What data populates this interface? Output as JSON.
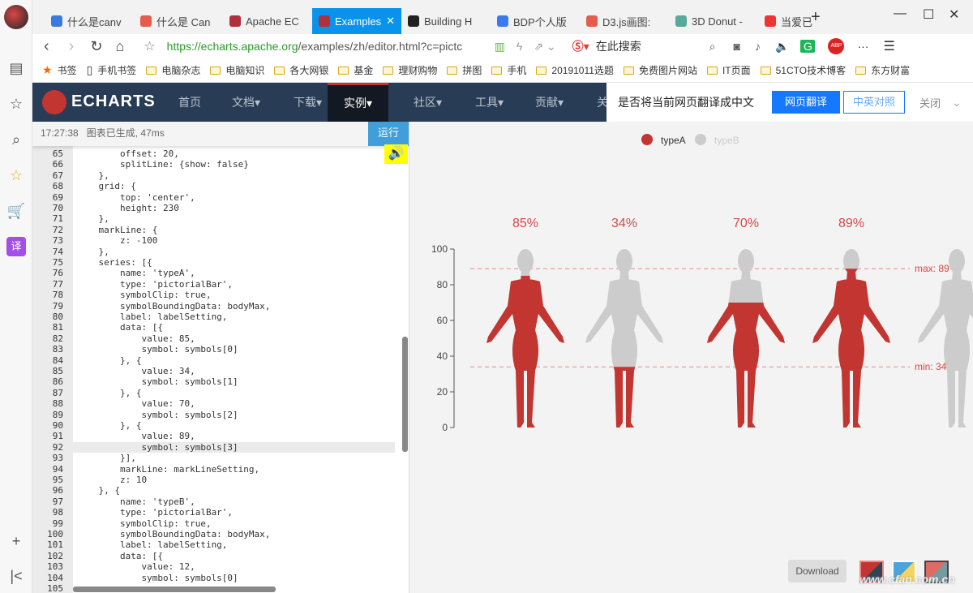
{
  "browser": {
    "tabs": [
      {
        "label": "什么是canv",
        "icon": "paw-icon",
        "color": "#3b7be0"
      },
      {
        "label": "什么是 Can",
        "icon": "jian-icon",
        "color": "#e35c4d"
      },
      {
        "label": "Apache EC",
        "icon": "echarts-icon",
        "color": "#b0303d"
      },
      {
        "label": "Examples",
        "icon": "echarts-icon",
        "color": "#b0303d",
        "active": true
      },
      {
        "label": "Building H",
        "icon": "cm-icon",
        "color": "#222"
      },
      {
        "label": "BDP个人版",
        "icon": "b-icon",
        "color": "#3a7cf0"
      },
      {
        "label": "D3.js画图:",
        "icon": "jian-icon",
        "color": "#e35c4d"
      },
      {
        "label": "3D Donut -",
        "icon": "donut-icon",
        "color": "#5a9"
      },
      {
        "label": "当爱已",
        "icon": "music-icon",
        "color": "#e33"
      }
    ],
    "url_host": "https://echarts.apache.org",
    "url_path": "/examples/zh/editor.html?c=pictc",
    "search_placeholder": "在此搜索",
    "bookmarks": [
      "书签",
      "手机书签",
      "电脑杂志",
      "电脑知识",
      "各大网银",
      "基金",
      "理财购物",
      "拼图",
      "手机",
      "20191011选题",
      "免费图片网站",
      "IT页面",
      "51CTO技术博客",
      "东方财富"
    ]
  },
  "site_nav": {
    "logo": "ECHARTS",
    "items": [
      "首页",
      "文档▾",
      "下载▾",
      "实例▾",
      "社区▾",
      "工具▾",
      "贡献▾",
      "关"
    ],
    "active": 3
  },
  "translate_bar": {
    "prompt": "是否将当前网页翻译成中文",
    "translate": "网页翻译",
    "bilingual": "中英对照",
    "close": "关闭"
  },
  "editor": {
    "status_time": "17:27:38",
    "status_msg": "图表已生成, 47ms",
    "run": "运行",
    "current_line": 92,
    "lines": [
      [
        "65",
        "        offset: 20,"
      ],
      [
        "66",
        "        splitLine: {show: false}"
      ],
      [
        "67",
        "    },"
      ],
      [
        "68",
        "    grid: {"
      ],
      [
        "69",
        "        top: 'center',"
      ],
      [
        "70",
        "        height: 230"
      ],
      [
        "71",
        "    },"
      ],
      [
        "72",
        "    markLine: {"
      ],
      [
        "73",
        "        z: -100"
      ],
      [
        "74",
        "    },"
      ],
      [
        "75",
        "    series: [{"
      ],
      [
        "76",
        "        name: 'typeA',"
      ],
      [
        "77",
        "        type: 'pictorialBar',"
      ],
      [
        "78",
        "        symbolClip: true,"
      ],
      [
        "79",
        "        symbolBoundingData: bodyMax,"
      ],
      [
        "80",
        "        label: labelSetting,"
      ],
      [
        "81",
        "        data: [{"
      ],
      [
        "82",
        "            value: 85,"
      ],
      [
        "83",
        "            symbol: symbols[0]"
      ],
      [
        "84",
        "        }, {"
      ],
      [
        "85",
        "            value: 34,"
      ],
      [
        "86",
        "            symbol: symbols[1]"
      ],
      [
        "87",
        "        }, {"
      ],
      [
        "88",
        "            value: 70,"
      ],
      [
        "89",
        "            symbol: symbols[2]"
      ],
      [
        "90",
        "        }, {"
      ],
      [
        "91",
        "            value: 89,"
      ],
      [
        "92",
        "            symbol: symbols[3]"
      ],
      [
        "93",
        "        }],"
      ],
      [
        "94",
        "        markLine: markLineSetting,"
      ],
      [
        "95",
        "        z: 10"
      ],
      [
        "96",
        "    }, {"
      ],
      [
        "97",
        "        name: 'typeB',"
      ],
      [
        "98",
        "        type: 'pictorialBar',"
      ],
      [
        "99",
        "        symbolClip: true,"
      ],
      [
        "100",
        "        symbolBoundingData: bodyMax,"
      ],
      [
        "101",
        "        label: labelSetting,"
      ],
      [
        "102",
        "        data: [{"
      ],
      [
        "103",
        "            value: 12,"
      ],
      [
        "104",
        "            symbol: symbols[0]"
      ],
      [
        "105",
        ""
      ]
    ]
  },
  "chart_data": {
    "type": "pictorialBar",
    "legend": [
      {
        "name": "typeA",
        "color": "#c23531",
        "active": true
      },
      {
        "name": "typeB",
        "color": "#cccccc",
        "active": false
      }
    ],
    "legend_position": "top",
    "values": [
      85,
      34,
      70,
      89
    ],
    "labels": [
      "85%",
      "34%",
      "70%",
      "89%"
    ],
    "ylim": [
      0,
      100
    ],
    "yticks": [
      0,
      20,
      40,
      60,
      80,
      100
    ],
    "markLines": [
      {
        "label": "max: 89",
        "value": 89
      },
      {
        "label": "min: 34",
        "value": 34
      }
    ],
    "colors": {
      "fill": "#c23531",
      "body": "#cccccc"
    }
  },
  "toolbox": {
    "download": "Download"
  },
  "watermark": "www.cfan.com.cn"
}
